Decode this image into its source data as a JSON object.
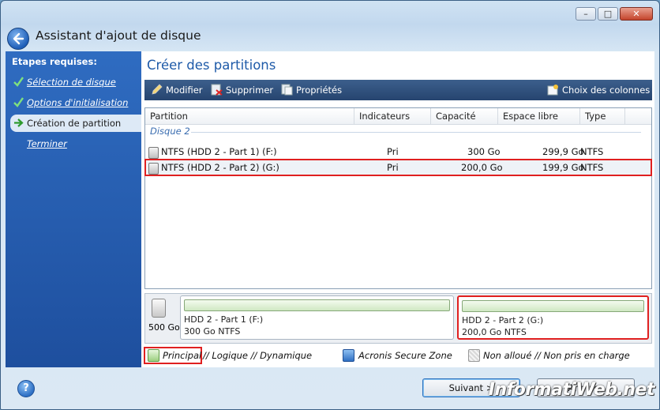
{
  "window": {
    "title": "Assistant d'ajout de disque"
  },
  "sidebar": {
    "heading": "Etapes requises:",
    "items": [
      {
        "label": "Sélection de disque",
        "state": "done"
      },
      {
        "label": "Options d'initialisation",
        "state": "done"
      },
      {
        "label": "Création de partition",
        "state": "current"
      },
      {
        "label": "Terminer",
        "state": "pending"
      }
    ]
  },
  "page": {
    "title": "Créer des partitions"
  },
  "toolbar": {
    "modify": "Modifier",
    "delete": "Supprimer",
    "properties": "Propriétés",
    "columns": "Choix des colonnes"
  },
  "table": {
    "columns": [
      "Partition",
      "Indicateurs",
      "Capacité",
      "Espace libre",
      "Type"
    ],
    "group": "Disque 2",
    "rows": [
      {
        "partition": "NTFS (HDD 2 - Part 1) (F:)",
        "flags": "Pri",
        "capacity": "300 Go",
        "free": "299,9 Go",
        "type": "NTFS"
      },
      {
        "partition": "NTFS (HDD 2 - Part 2) (G:)",
        "flags": "Pri",
        "capacity": "200,0 Go",
        "free": "199,9 Go",
        "type": "NTFS"
      }
    ]
  },
  "diskmap": {
    "size": "500 Go",
    "parts": [
      {
        "name": "HDD 2 - Part 1 (F:)",
        "detail": "300 Go  NTFS"
      },
      {
        "name": "HDD 2 - Part 2 (G:)",
        "detail": "200,0 Go  NTFS"
      }
    ]
  },
  "legend": {
    "principal": "Principal",
    "rest": "// Logique // Dynamique",
    "secure": "Acronis Secure Zone",
    "unallocated": "Non alloué // Non pris en charge"
  },
  "footer": {
    "next": "Suivant >",
    "cancel": "Annuler",
    "help": "?"
  },
  "watermark": "InformatiWeb.net",
  "colors": {
    "accent": "#1e5aa8",
    "highlight": "#e02020",
    "sidebar": "#2f6cc1",
    "toolbar": "#2f5180"
  }
}
